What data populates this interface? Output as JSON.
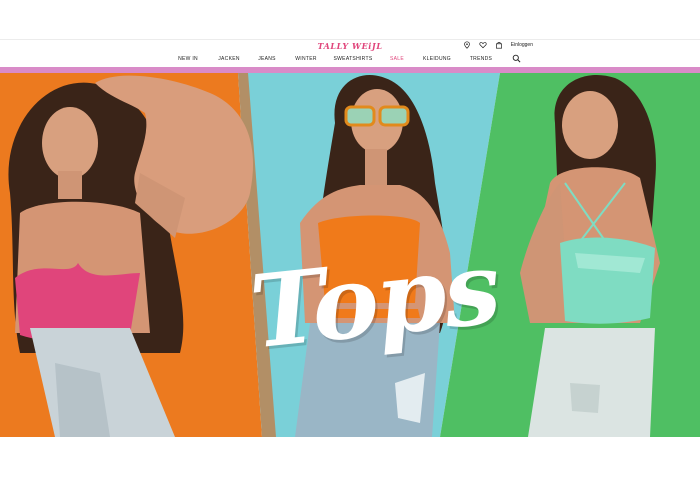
{
  "brand": {
    "name": "TALLY WEiJL",
    "color": "#e0457b"
  },
  "header": {
    "login_label": "Einloggen",
    "icons": [
      "location-pin-icon",
      "heart-icon",
      "shopping-bag-icon",
      "search-icon"
    ]
  },
  "nav": {
    "items": [
      {
        "label": "NEW IN",
        "highlight": false
      },
      {
        "label": "JACKEN",
        "highlight": false
      },
      {
        "label": "JEANS",
        "highlight": false
      },
      {
        "label": "WINTER",
        "highlight": false
      },
      {
        "label": "SWEATSHIRTS",
        "highlight": false
      },
      {
        "label": "SALE",
        "highlight": true
      },
      {
        "label": "KLEIDUNG",
        "highlight": false
      },
      {
        "label": "TRENDS",
        "highlight": false
      }
    ],
    "sale_color": "#e0457b"
  },
  "accent_bar": {
    "color": "#d98bc8"
  },
  "hero": {
    "title": "Tops",
    "panels": [
      {
        "name": "left",
        "bg": "#ec7a1f",
        "top_color": "#e0457b"
      },
      {
        "name": "center",
        "bg": "#7ad0d8",
        "top_color": "#f07a1a"
      },
      {
        "name": "right",
        "bg": "#4fbf63",
        "top_color": "#7fdcc2"
      }
    ]
  }
}
